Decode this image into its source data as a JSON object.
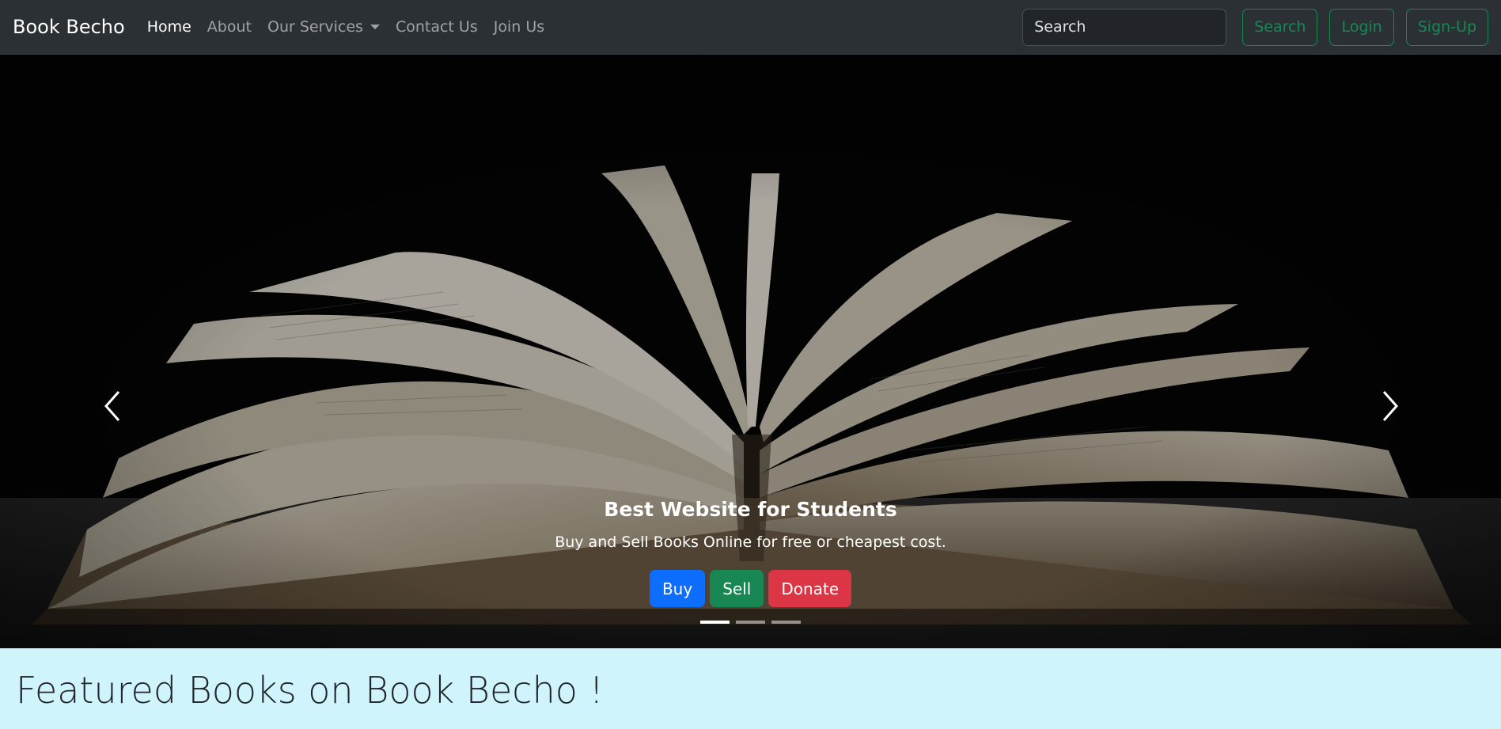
{
  "navbar": {
    "brand": "Book Becho",
    "links": [
      {
        "label": "Home",
        "active": true
      },
      {
        "label": "About"
      },
      {
        "label": "Our Services",
        "dropdown": true
      },
      {
        "label": "Contact Us"
      },
      {
        "label": "Join Us"
      }
    ],
    "search_placeholder": "Search",
    "search_button": "Search",
    "login_button": "Login",
    "signup_button": "Sign-Up"
  },
  "carousel": {
    "caption_title": "Best Website for Students",
    "caption_text": "Buy and Sell Books Online for free or cheapest cost.",
    "buttons": {
      "buy": "Buy",
      "sell": "Sell",
      "donate": "Donate"
    },
    "slides_count": 3,
    "active_slide": 1,
    "icons": {
      "prev": "chevron-left-icon",
      "next": "chevron-right-icon"
    }
  },
  "featured": {
    "heading": "Featured Books on Book Becho !"
  },
  "colors": {
    "navbar_bg": "#2b3035",
    "success": "#198754",
    "primary": "#0d6efd",
    "danger": "#dc3545",
    "info_bg": "#cff4fc"
  }
}
